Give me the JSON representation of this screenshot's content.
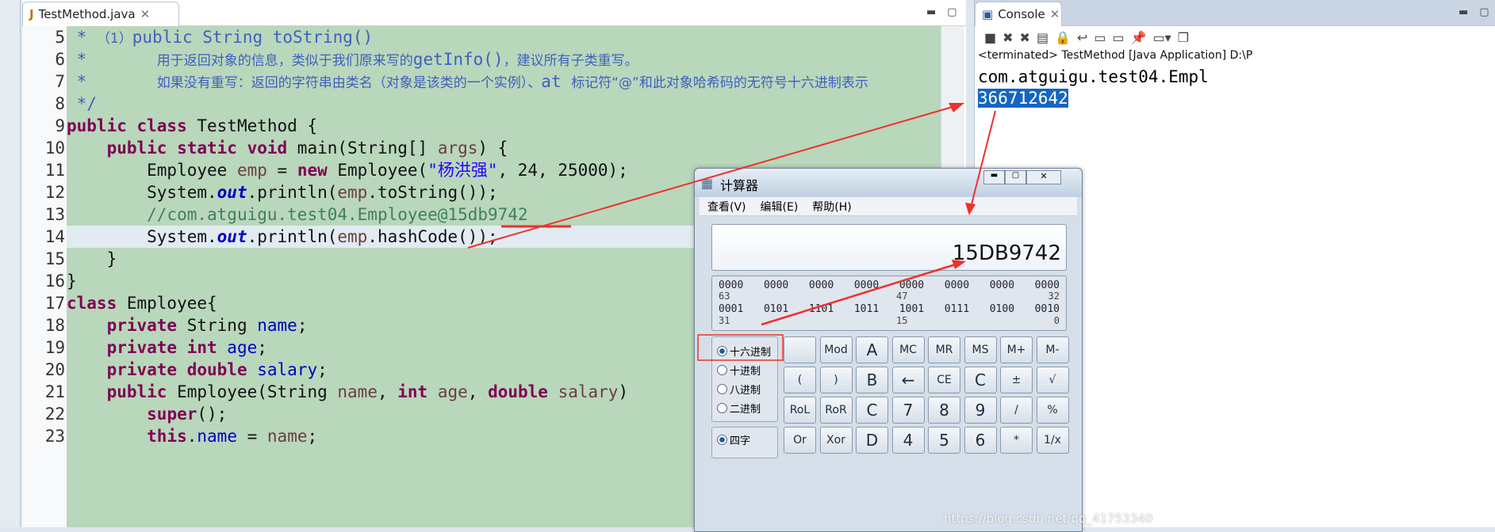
{
  "editor": {
    "tab_label": "TestMethod.java",
    "lines": [
      {
        "n": "5",
        "tokens": [
          [
            "doc",
            " * "
          ],
          [
            "cjk doc",
            "（1）"
          ],
          [
            "doc",
            "public String toString()"
          ]
        ]
      },
      {
        "n": "6",
        "tokens": [
          [
            "doc",
            " *       "
          ],
          [
            "cjk doc",
            "用于返回对象的信息，类似于我们原来写的"
          ],
          [
            "doc",
            "getInfo()"
          ],
          [
            "cjk doc",
            "，建议所有子类重写。"
          ]
        ]
      },
      {
        "n": "7",
        "tokens": [
          [
            "doc",
            " *       "
          ],
          [
            "cjk doc",
            "如果没有重写：返回的字符串由类名（对象是该类的一个实例）、"
          ],
          [
            "doc",
            "at "
          ],
          [
            "cjk doc",
            "标记符“@”和此对象哈希码的无符号十六进制表示"
          ]
        ]
      },
      {
        "n": "8",
        "tokens": [
          [
            "doc",
            " */"
          ]
        ]
      },
      {
        "n": "9",
        "tokens": [
          [
            "kw",
            "public class "
          ],
          [
            "",
            "TestMethod {"
          ]
        ]
      },
      {
        "n": "10",
        "tokens": [
          [
            "",
            "    "
          ],
          [
            "kw",
            "public static void "
          ],
          [
            "",
            "main(String[] "
          ],
          [
            "var",
            "args"
          ],
          [
            "",
            ") {"
          ]
        ]
      },
      {
        "n": "11",
        "tokens": [
          [
            "",
            "        Employee "
          ],
          [
            "var",
            "emp"
          ],
          [
            "",
            " = "
          ],
          [
            "kw",
            "new "
          ],
          [
            "",
            "Employee("
          ],
          [
            "str",
            "\"杨洪强\""
          ],
          [
            "",
            ", 24, 25000);"
          ]
        ]
      },
      {
        "n": "12",
        "tokens": [
          [
            "",
            "        System."
          ],
          [
            "st",
            "out"
          ],
          [
            "",
            ".println("
          ],
          [
            "var",
            "emp"
          ],
          [
            "",
            ".toString());"
          ]
        ]
      },
      {
        "n": "13",
        "tokens": [
          [
            "",
            "        "
          ],
          [
            "cm",
            "//com.atguigu.test04.Employee@15db9742"
          ]
        ]
      },
      {
        "n": "14",
        "tokens": [
          [
            "",
            "        System."
          ],
          [
            "st",
            "out"
          ],
          [
            "",
            ".println("
          ],
          [
            "var",
            "emp"
          ],
          [
            "",
            ".hashCode());"
          ]
        ]
      },
      {
        "n": "15",
        "tokens": [
          [
            "",
            "    }"
          ]
        ]
      },
      {
        "n": "16",
        "tokens": [
          [
            "",
            "}"
          ]
        ]
      },
      {
        "n": "17",
        "tokens": [
          [
            "kw",
            "class "
          ],
          [
            "",
            "Employee{"
          ]
        ]
      },
      {
        "n": "18",
        "tokens": [
          [
            "",
            "    "
          ],
          [
            "kw",
            "private "
          ],
          [
            "",
            "String "
          ],
          [
            "fld",
            "name"
          ],
          [
            "",
            ";"
          ]
        ]
      },
      {
        "n": "19",
        "tokens": [
          [
            "",
            "    "
          ],
          [
            "kw",
            "private int "
          ],
          [
            "fld",
            "age"
          ],
          [
            "",
            ";"
          ]
        ]
      },
      {
        "n": "20",
        "tokens": [
          [
            "",
            "    "
          ],
          [
            "kw",
            "private double "
          ],
          [
            "fld",
            "salary"
          ],
          [
            "",
            ";"
          ]
        ]
      },
      {
        "n": "21",
        "tokens": [
          [
            "",
            "    "
          ],
          [
            "kw",
            "public "
          ],
          [
            "",
            "Employee(String "
          ],
          [
            "var",
            "name"
          ],
          [
            "",
            ", "
          ],
          [
            "kw",
            "int "
          ],
          [
            "var",
            "age"
          ],
          [
            "",
            ", "
          ],
          [
            "kw",
            "double "
          ],
          [
            "var",
            "salary"
          ],
          [
            "",
            ")"
          ]
        ]
      },
      {
        "n": "22",
        "tokens": [
          [
            "",
            "        "
          ],
          [
            "kw",
            "super"
          ],
          [
            "",
            "();"
          ]
        ]
      },
      {
        "n": "23",
        "tokens": [
          [
            "",
            "        "
          ],
          [
            "kw",
            "this"
          ],
          [
            "",
            "."
          ],
          [
            "fld",
            "name"
          ],
          [
            "",
            " = "
          ],
          [
            "var",
            "name"
          ],
          [
            "",
            ";"
          ]
        ]
      }
    ]
  },
  "console": {
    "tab_label": "Console",
    "status": "<terminated> TestMethod [Java Application] D:\\P",
    "output": [
      "com.atguigu.test04.Empl",
      "366712642"
    ]
  },
  "calculator": {
    "title": "计算器",
    "menu": [
      "查看(V)",
      "编辑(E)",
      "帮助(H)"
    ],
    "display": "15DB9742",
    "bits": {
      "row1": [
        "0000",
        "0000",
        "0000",
        "0000",
        "0000",
        "0000",
        "0000",
        "0000"
      ],
      "row1_idx": [
        "63",
        "47",
        "32"
      ],
      "row2": [
        "0001",
        "0101",
        "1101",
        "1011",
        "1001",
        "0111",
        "0100",
        "0010"
      ],
      "row2_idx": [
        "31",
        "15",
        "0"
      ]
    },
    "radix": [
      "十六进制",
      "十进制",
      "八进制",
      "二进制"
    ],
    "radix_selected": "十六进制",
    "word": "四字",
    "buttons": [
      [
        "",
        "Mod",
        "A",
        "MC",
        "MR",
        "MS",
        "M+",
        "M-"
      ],
      [
        "(",
        ")",
        "B",
        "←",
        "CE",
        "C",
        "±",
        "√"
      ],
      [
        "RoL",
        "RoR",
        "C",
        "7",
        "8",
        "9",
        "/",
        "%"
      ],
      [
        "Or",
        "Xor",
        "D",
        "4",
        "5",
        "6",
        "*",
        "1/x"
      ]
    ]
  },
  "watermark": "https://blog.csdn.net/qq_41753340",
  "colors": {
    "annotation": "#f0302a",
    "code_bg": "#b9d7bb",
    "selection": "#1565c0"
  }
}
